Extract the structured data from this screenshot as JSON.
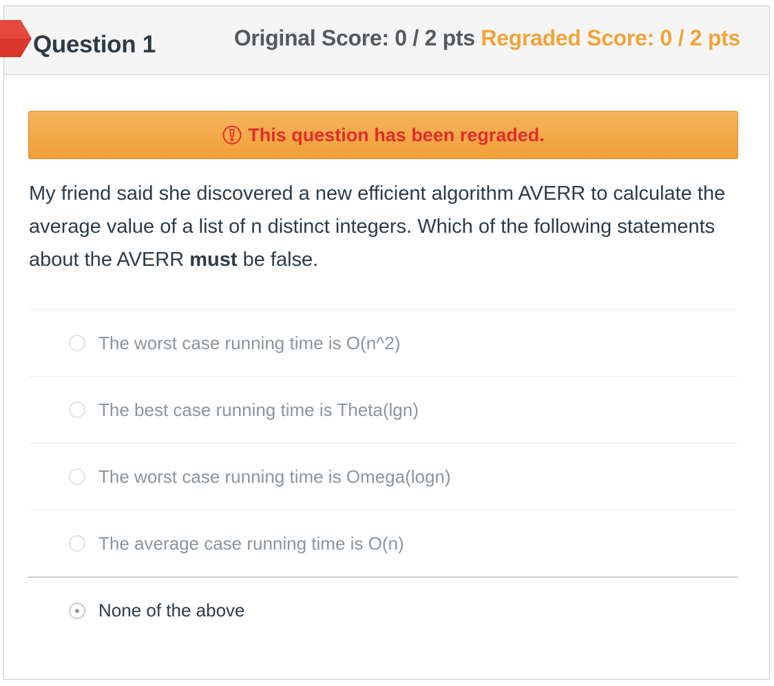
{
  "question": {
    "title": "Question 1",
    "original_score": "Original Score: 0 / 2 pts",
    "regraded_score": "Regraded Score: 0 / 2 pts"
  },
  "banner": {
    "text": "This question has been regraded.",
    "icon": "warning-icon"
  },
  "prompt": {
    "part1": "My friend said she discovered a new efficient algorithm AVERR to calculate the average value of a list of n distinct integers.  Which of the following statements about the AVERR ",
    "emphasis": "must",
    "part2": " be false."
  },
  "answers": [
    {
      "label": "The worst case running time is O(n^2)",
      "selected": false
    },
    {
      "label": "The best case running time is Theta(lgn)",
      "selected": false
    },
    {
      "label": "The worst case running time is Omega(logn)",
      "selected": false
    },
    {
      "label": "The average case running time is O(n)",
      "selected": false
    },
    {
      "label": "None of the above",
      "selected": true
    }
  ],
  "colors": {
    "regraded": "#f2a33a",
    "banner_text": "#e02d2d",
    "flag": "#d9372b"
  }
}
